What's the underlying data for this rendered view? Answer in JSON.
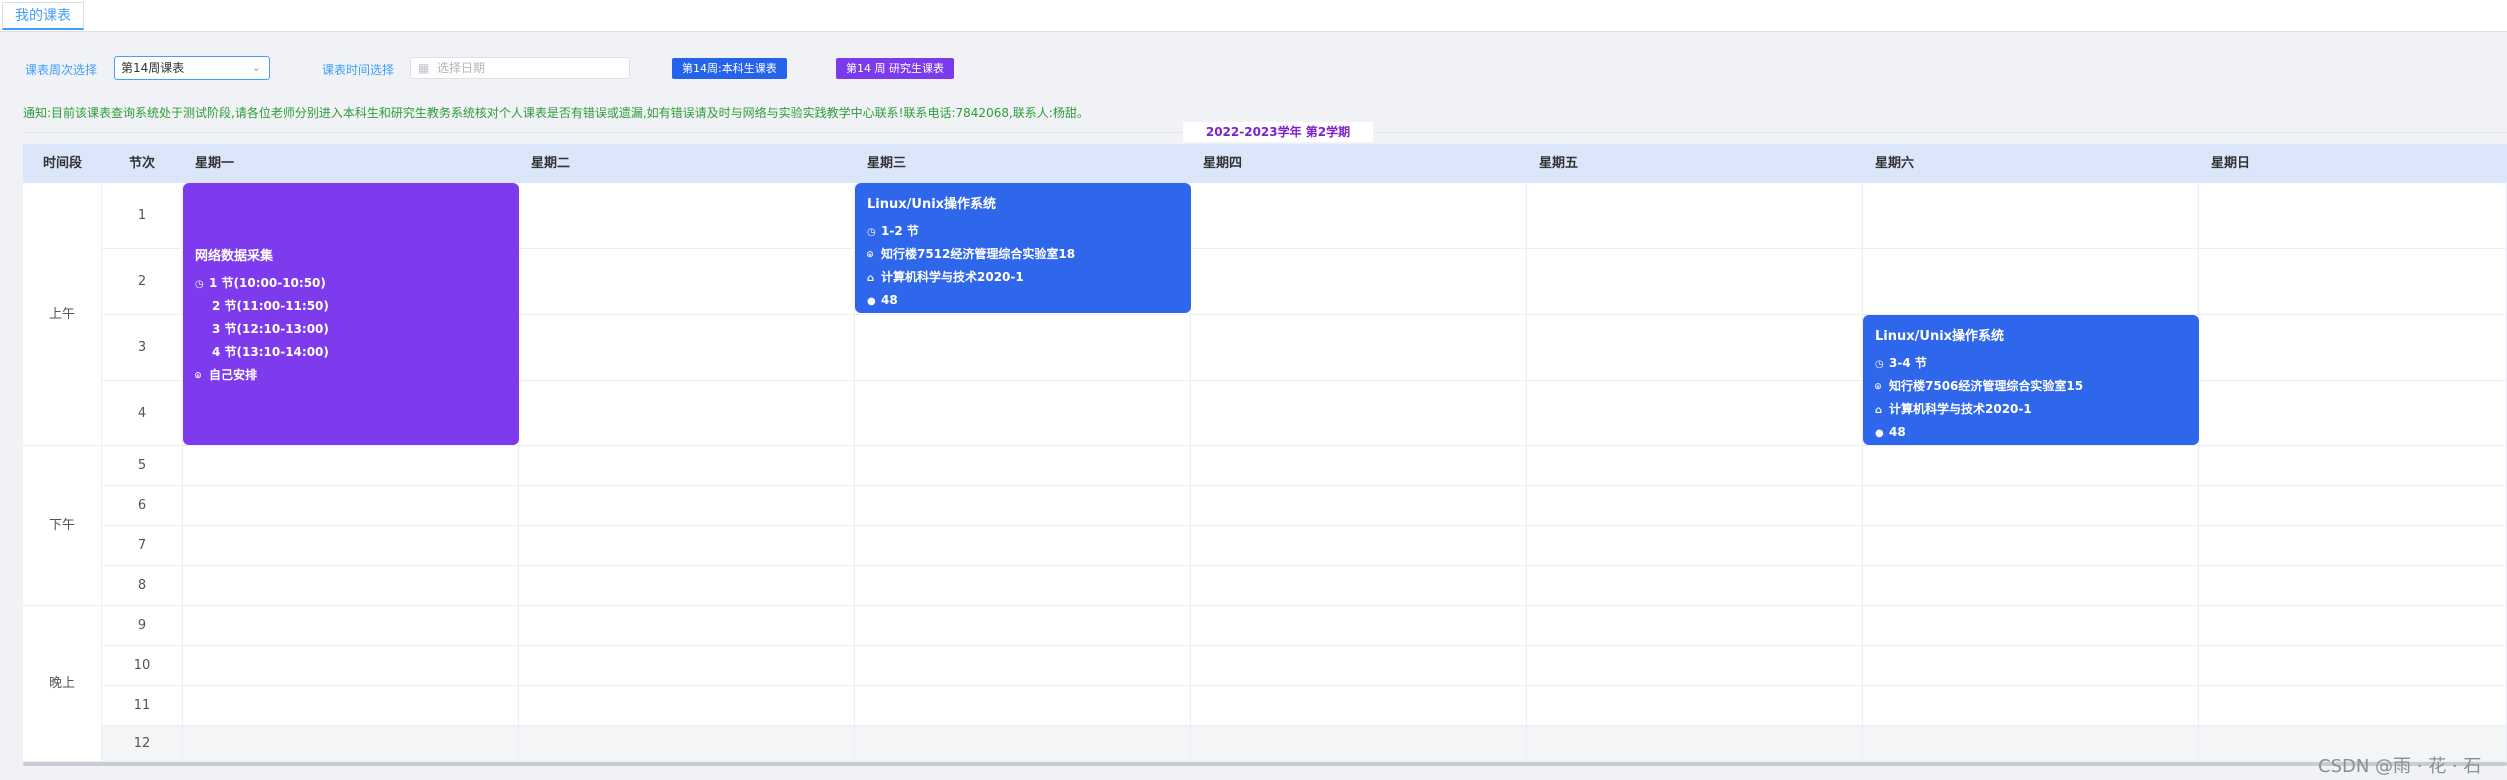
{
  "tab": {
    "label": "我的课表"
  },
  "filters": {
    "week_label": "课表周次选择",
    "week_value": "第14周课表",
    "date_label": "课表时间选择",
    "date_placeholder": "选择日期",
    "btn_undergrad": "第14周:本科生课表",
    "btn_grad": "第14 周 研究生课表"
  },
  "notice": "通知:目前该课表查询系统处于测试阶段,请各位老师分别进入本科生和研究生教务系统核对个人课表是否有错误或遗漏,如有错误请及时与网络与实验实践教学中心联系!联系电话:7842068,联系人:杨甜。",
  "term": "2022-2023学年 第2学期",
  "headers": {
    "period": "时间段",
    "section": "节次",
    "days": [
      "星期一",
      "星期二",
      "星期三",
      "星期四",
      "星期五",
      "星期六",
      "星期日"
    ]
  },
  "periods": [
    "上午",
    "下午",
    "晚上"
  ],
  "sections": [
    "1",
    "2",
    "3",
    "4",
    "5",
    "6",
    "7",
    "8",
    "9",
    "10",
    "11",
    "12"
  ],
  "courses": [
    {
      "title": "网络数据采集",
      "color": "#7e3aed",
      "lines": [
        "1 节(10:00-10:50)",
        "2 节(11:00-11:50)",
        "3 节(12:10-13:00)",
        "4 节(13:10-14:00)"
      ],
      "location": "自己安排"
    },
    {
      "title": "Linux/Unix操作系统",
      "color": "#2f67ec",
      "sections": "1-2 节",
      "location": "知行楼7512经济管理综合实验室18",
      "class": "计算机科学与技术2020-1",
      "students": "48"
    },
    {
      "title": "Linux/Unix操作系统",
      "color": "#2f67ec",
      "sections": "3-4 节",
      "location": "知行楼7506经济管理综合实验室15",
      "class": "计算机科学与技术2020-1",
      "students": "48"
    }
  ],
  "watermark": "CSDN @雨 · 花 · 石"
}
